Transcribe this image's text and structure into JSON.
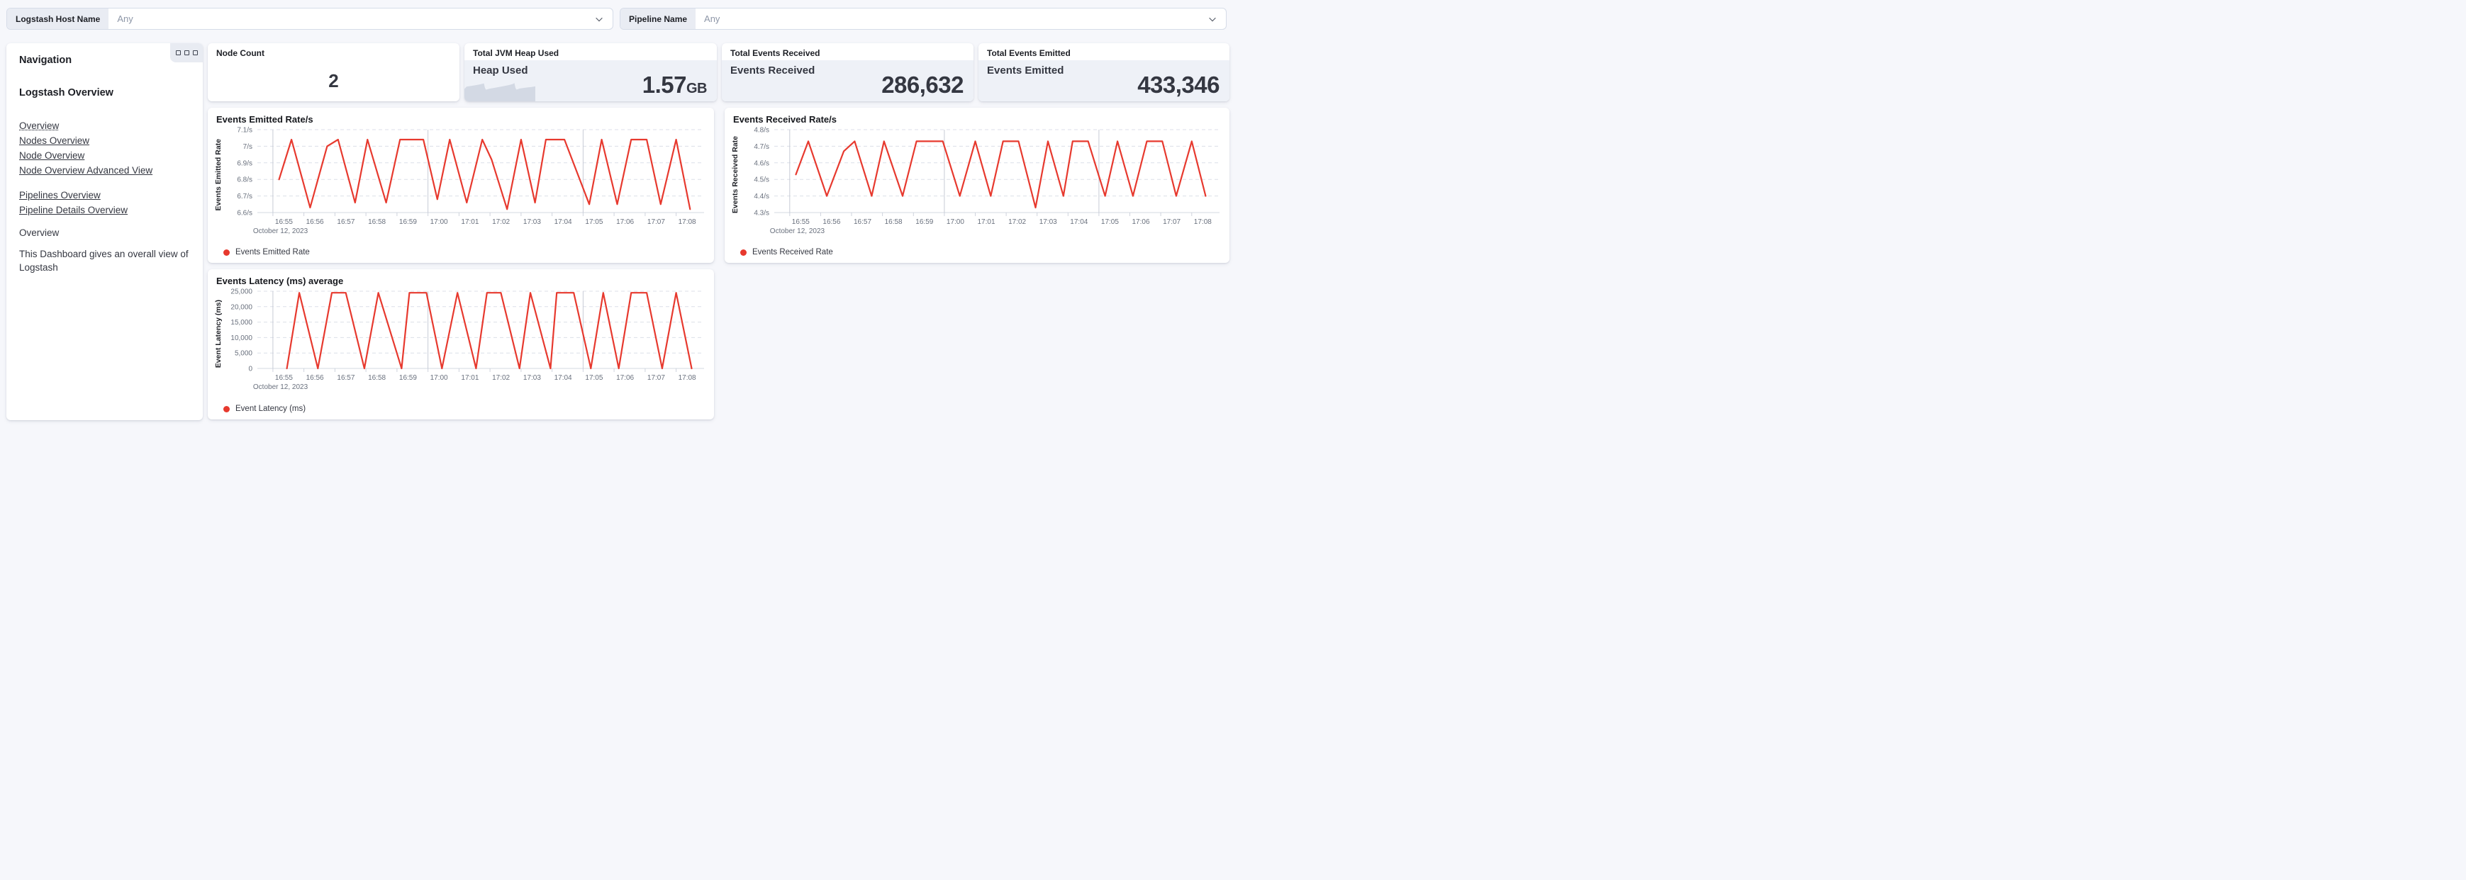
{
  "filters": [
    {
      "label": "Logstash Host Name",
      "value": "Any"
    },
    {
      "label": "Pipeline Name",
      "value": "Any"
    }
  ],
  "nav": {
    "heading": "Navigation",
    "section_title": "Logstash Overview",
    "links_primary": [
      {
        "label": "Overview",
        "current": true
      },
      {
        "label": "Nodes Overview",
        "current": false
      },
      {
        "label": "Node Overview",
        "current": false
      },
      {
        "label": "Node Overview Advanced View",
        "current": false
      }
    ],
    "links_secondary": [
      {
        "label": "Pipelines Overview"
      },
      {
        "label": "Pipeline Details Overview"
      }
    ],
    "subheading": "Overview",
    "description": "This Dashboard gives an overall view of Logstash"
  },
  "metrics": {
    "node_count": {
      "title": "Node Count",
      "value": "2"
    },
    "jvm_heap": {
      "title": "Total JVM Heap Used",
      "label": "Heap Used",
      "value": "1.57",
      "unit": "GB",
      "area_color": "#d3d9e4",
      "sparkline": [
        [
          0,
          0.62
        ],
        [
          0.03,
          0.55
        ],
        [
          0.12,
          0.52
        ],
        [
          0.2,
          0.49
        ],
        [
          0.26,
          0.46
        ],
        [
          0.275,
          0.45
        ],
        [
          0.29,
          0.59
        ],
        [
          0.305,
          0.645
        ],
        [
          0.35,
          0.615
        ],
        [
          0.45,
          0.575
        ],
        [
          0.55,
          0.535
        ],
        [
          0.63,
          0.5
        ],
        [
          0.68,
          0.47
        ],
        [
          0.705,
          0.44
        ],
        [
          0.72,
          0.59
        ],
        [
          0.735,
          0.64
        ],
        [
          0.78,
          0.605
        ],
        [
          0.88,
          0.575
        ],
        [
          0.95,
          0.56
        ],
        [
          1,
          0.54
        ]
      ]
    },
    "events_received": {
      "title": "Total Events Received",
      "label": "Events Received",
      "value": "286,632"
    },
    "events_emitted": {
      "title": "Total Events Emitted",
      "label": "Events Emitted",
      "value": "433,346"
    }
  },
  "chart_data": [
    {
      "type": "line",
      "title": "Events Emitted Rate/s",
      "ylabel": "Events Emitted Rate",
      "legend": "Events Emitted Rate",
      "color": "#e7392e",
      "y_domain": [
        6.6,
        7.1
      ],
      "y_ticks": [
        {
          "v": 6.6,
          "label": "6.6/s"
        },
        {
          "v": 6.7,
          "label": "6.7/s"
        },
        {
          "v": 6.8,
          "label": "6.8/s"
        },
        {
          "v": 6.9,
          "label": "6.9/s"
        },
        {
          "v": 7.0,
          "label": "7/s"
        },
        {
          "v": 7.1,
          "label": "7.1/s"
        }
      ],
      "x_domain": [
        0,
        14.4
      ],
      "x_tick_start": 0.5,
      "x_tick_labels": [
        "16:55",
        "16:56",
        "16:57",
        "16:58",
        "16:59",
        "17:00",
        "17:01",
        "17:02",
        "17:03",
        "17:04",
        "17:05",
        "17:06",
        "17:07",
        "17:08"
      ],
      "x_major": [
        0.5,
        5.5,
        10.5
      ],
      "x_date": "October 12, 2023",
      "points": [
        [
          0.7,
          6.8
        ],
        [
          1.1,
          7.04
        ],
        [
          1.7,
          6.63
        ],
        [
          2.25,
          7.0
        ],
        [
          2.6,
          7.04
        ],
        [
          3.15,
          6.66
        ],
        [
          3.55,
          7.04
        ],
        [
          4.15,
          6.66
        ],
        [
          4.6,
          7.04
        ],
        [
          5.35,
          7.04
        ],
        [
          5.8,
          6.68
        ],
        [
          6.2,
          7.04
        ],
        [
          6.75,
          6.66
        ],
        [
          7.25,
          7.04
        ],
        [
          7.55,
          6.92
        ],
        [
          8.05,
          6.62
        ],
        [
          8.5,
          7.04
        ],
        [
          8.95,
          6.66
        ],
        [
          9.3,
          7.04
        ],
        [
          9.9,
          7.04
        ],
        [
          10.7,
          6.65
        ],
        [
          11.1,
          7.04
        ],
        [
          11.6,
          6.65
        ],
        [
          12.05,
          7.04
        ],
        [
          12.55,
          7.04
        ],
        [
          13.0,
          6.65
        ],
        [
          13.5,
          7.04
        ],
        [
          13.95,
          6.62
        ]
      ]
    },
    {
      "type": "line",
      "title": "Events Received Rate/s",
      "ylabel": "Events Received Rate",
      "legend": "Events Received Rate",
      "color": "#e7392e",
      "y_domain": [
        4.3,
        4.8
      ],
      "y_ticks": [
        {
          "v": 4.3,
          "label": "4.3/s"
        },
        {
          "v": 4.4,
          "label": "4.4/s"
        },
        {
          "v": 4.5,
          "label": "4.5/s"
        },
        {
          "v": 4.6,
          "label": "4.6/s"
        },
        {
          "v": 4.7,
          "label": "4.7/s"
        },
        {
          "v": 4.8,
          "label": "4.8/s"
        }
      ],
      "x_domain": [
        0,
        14.4
      ],
      "x_tick_start": 0.5,
      "x_tick_labels": [
        "16:55",
        "16:56",
        "16:57",
        "16:58",
        "16:59",
        "17:00",
        "17:01",
        "17:02",
        "17:03",
        "17:04",
        "17:05",
        "17:06",
        "17:07",
        "17:08"
      ],
      "x_major": [
        0.5,
        5.5,
        10.5
      ],
      "x_date": "October 12, 2023",
      "points": [
        [
          0.7,
          4.53
        ],
        [
          1.1,
          4.73
        ],
        [
          1.7,
          4.4
        ],
        [
          2.25,
          4.67
        ],
        [
          2.6,
          4.73
        ],
        [
          3.15,
          4.4
        ],
        [
          3.55,
          4.73
        ],
        [
          4.15,
          4.4
        ],
        [
          4.6,
          4.73
        ],
        [
          5.45,
          4.73
        ],
        [
          6.0,
          4.4
        ],
        [
          6.5,
          4.73
        ],
        [
          7.0,
          4.4
        ],
        [
          7.4,
          4.73
        ],
        [
          7.9,
          4.73
        ],
        [
          8.45,
          4.33
        ],
        [
          8.85,
          4.73
        ],
        [
          9.35,
          4.4
        ],
        [
          9.65,
          4.73
        ],
        [
          10.15,
          4.73
        ],
        [
          10.7,
          4.4
        ],
        [
          11.1,
          4.73
        ],
        [
          11.6,
          4.4
        ],
        [
          12.05,
          4.73
        ],
        [
          12.55,
          4.73
        ],
        [
          13.0,
          4.4
        ],
        [
          13.5,
          4.73
        ],
        [
          13.95,
          4.4
        ]
      ]
    },
    {
      "type": "line",
      "title": "Events Latency (ms) average",
      "ylabel": "Event Latency (ms)",
      "legend": "Event Latency (ms)",
      "color": "#e7392e",
      "y_domain": [
        0,
        25000
      ],
      "y_ticks": [
        {
          "v": 0,
          "label": "0"
        },
        {
          "v": 5000,
          "label": "5,000"
        },
        {
          "v": 10000,
          "label": "10,000"
        },
        {
          "v": 15000,
          "label": "15,000"
        },
        {
          "v": 20000,
          "label": "20,000"
        },
        {
          "v": 25000,
          "label": "25,000"
        }
      ],
      "x_domain": [
        0,
        14.4
      ],
      "x_tick_start": 0.5,
      "x_tick_labels": [
        "16:55",
        "16:56",
        "16:57",
        "16:58",
        "16:59",
        "17:00",
        "17:01",
        "17:02",
        "17:03",
        "17:04",
        "17:05",
        "17:06",
        "17:07",
        "17:08"
      ],
      "x_major": [
        0.5,
        5.5,
        10.5
      ],
      "x_date": "October 12, 2023",
      "points": [
        [
          0.95,
          0
        ],
        [
          1.35,
          24500
        ],
        [
          1.95,
          0
        ],
        [
          2.4,
          24500
        ],
        [
          2.85,
          24500
        ],
        [
          3.45,
          0
        ],
        [
          3.9,
          24500
        ],
        [
          4.65,
          0
        ],
        [
          4.9,
          24500
        ],
        [
          5.45,
          24500
        ],
        [
          5.95,
          0
        ],
        [
          6.45,
          24500
        ],
        [
          7.05,
          0
        ],
        [
          7.4,
          24500
        ],
        [
          7.85,
          24500
        ],
        [
          8.45,
          0
        ],
        [
          8.8,
          24500
        ],
        [
          9.45,
          0
        ],
        [
          9.65,
          24500
        ],
        [
          10.2,
          24500
        ],
        [
          10.75,
          0
        ],
        [
          11.15,
          24500
        ],
        [
          11.65,
          0
        ],
        [
          12.05,
          24500
        ],
        [
          12.55,
          24500
        ],
        [
          13.05,
          0
        ],
        [
          13.5,
          24500
        ],
        [
          14.0,
          0
        ]
      ]
    }
  ]
}
